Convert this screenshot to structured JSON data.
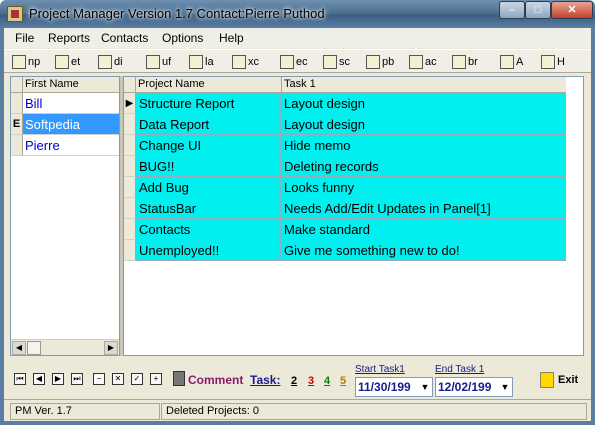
{
  "window": {
    "title": "Project Manager Version 1.7    Contact:Pierre Puthod",
    "min_label": "–",
    "max_label": "□",
    "close_label": "✕"
  },
  "menu": [
    "File",
    "Reports",
    "Contacts",
    "Options",
    "Help"
  ],
  "toolbar": [
    {
      "icon": "print-icon",
      "label": "np"
    },
    {
      "icon": "print-icon",
      "label": "et"
    },
    {
      "icon": "pencil-icon",
      "label": "di"
    },
    {
      "icon": "printer-icon",
      "label": "uf"
    },
    {
      "icon": "report-icon",
      "label": "la"
    },
    {
      "icon": "folder-icon",
      "label": "xc"
    },
    {
      "icon": "document-icon",
      "label": "ec"
    },
    {
      "icon": "document-icon",
      "label": "sc"
    },
    {
      "icon": "notepad-icon",
      "label": "pb"
    },
    {
      "icon": "tools-icon",
      "label": "ac"
    },
    {
      "icon": "list-icon",
      "label": "br"
    },
    {
      "icon": "bulb-icon",
      "label": "A"
    },
    {
      "icon": "question-icon",
      "label": "H"
    }
  ],
  "contacts_grid": {
    "header": "First Name",
    "rows": [
      {
        "indicator": "",
        "name": "Bill",
        "selected": false
      },
      {
        "indicator": "E",
        "name": "Softpedia",
        "selected": true
      },
      {
        "indicator": "",
        "name": "Pierre",
        "selected": false
      }
    ]
  },
  "projects_grid": {
    "headers": [
      "Project Name",
      "Task 1"
    ],
    "rows": [
      {
        "indicator": "▶",
        "project": "Structure Report",
        "task": "Layout design"
      },
      {
        "indicator": "",
        "project": "Data Report",
        "task": "Layout design"
      },
      {
        "indicator": "",
        "project": "Change UI",
        "task": "Hide memo"
      },
      {
        "indicator": "",
        "project": "BUG!!",
        "task": "Deleting records"
      },
      {
        "indicator": "",
        "project": "Add Bug",
        "task": "Looks funny"
      },
      {
        "indicator": "",
        "project": "StatusBar",
        "task": "Needs Add/Edit Updates in Panel[1]"
      },
      {
        "indicator": "",
        "project": "Contacts",
        "task": "Make standard"
      },
      {
        "indicator": "",
        "project": "Unemployed!!",
        "task": "Give me something new to do!"
      }
    ]
  },
  "navigator": [
    "⏮",
    "◀",
    "▶",
    "⏭",
    "−",
    "✕",
    "✓",
    "+"
  ],
  "comment_label": "Comment",
  "task_label": "Task:",
  "task_numbers": [
    {
      "label": "2",
      "color": "#000000"
    },
    {
      "label": "3",
      "color": "#cc0000"
    },
    {
      "label": "4",
      "color": "#008800"
    },
    {
      "label": "5",
      "color": "#b08000"
    }
  ],
  "start_task": {
    "label": "Start Task1",
    "value": "11/30/199"
  },
  "end_task": {
    "label": "End Task 1",
    "value": "12/02/199"
  },
  "exit_label": "Exit",
  "status": {
    "version": "PM Ver. 1.7",
    "deleted": "Deleted Projects:  0"
  }
}
